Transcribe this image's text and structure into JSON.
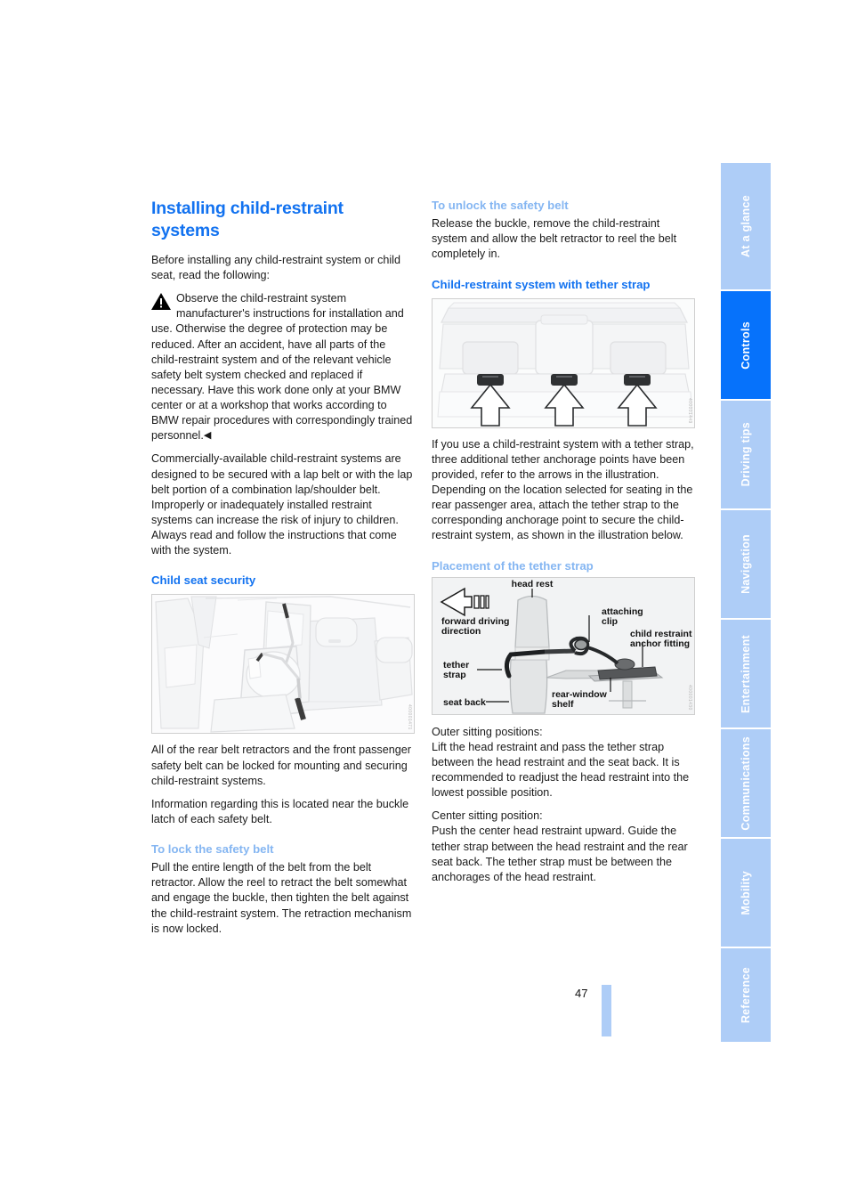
{
  "page": {
    "number": "47",
    "accent_blue": "#1272f0",
    "light_blue": "#85b6f2",
    "tab_active_blue": "#0672fb",
    "tab_inactive_blue": "#aecdf7"
  },
  "tabs": [
    {
      "label": "At a glance",
      "active": false
    },
    {
      "label": "Controls",
      "active": true
    },
    {
      "label": "Driving tips",
      "active": false
    },
    {
      "label": "Navigation",
      "active": false
    },
    {
      "label": "Entertainment",
      "active": false
    },
    {
      "label": "Communications",
      "active": false
    },
    {
      "label": "Mobility",
      "active": false
    },
    {
      "label": "Reference",
      "active": false
    }
  ],
  "left_column": {
    "title": "Installing child-restraint systems",
    "intro": "Before installing any child-restraint system or child seat, read the following:",
    "warning": "Observe the child-restraint system manufacturer's instructions for installation and use. Otherwise the degree of protection may be reduced. After an accident, have all parts of the child-restraint system and of the relevant vehicle safety belt system checked and replaced if necessary. Have this work done only at your BMW center or at a workshop that works according to BMW repair procedures with correspondingly trained personnel.",
    "warning_end_mark": "◀",
    "para_commercial": "Commercially-available child-restraint systems are designed to be secured with a lap belt or with the lap belt portion of a combination lap/shoulder belt. Improperly or inadequately installed restraint systems can increase the risk of injury to children. Always read and follow the instructions that come with the system.",
    "heading_child_seat_security": "Child seat security",
    "figure_interior_code": "400001471",
    "para_retractors": "All of the rear belt retractors and the front passenger safety belt can be locked for mounting and securing child-restraint systems.",
    "para_buckle_info": "Information regarding this is located near the buckle latch of each safety belt.",
    "heading_lock_belt": "To lock the safety belt",
    "para_lock_belt": "Pull the entire length of the belt from the belt retractor. Allow the reel to retract the belt somewhat and engage the buckle, then tighten the belt against the child-restraint system. The retraction mechanism is now locked."
  },
  "right_column": {
    "heading_unlock_belt": "To unlock the safety belt",
    "para_unlock_belt": "Release the buckle, remove the child-restraint system and allow the belt retractor to reel the belt completely in.",
    "heading_tether_system": "Child-restraint system with tether strap",
    "figure_anchorage_code": "400001449",
    "para_tether_anchorage": "If you use a child-restraint system with a tether strap, three additional tether anchorage points have been provided, refer to the arrows in the illustration. Depending on the location selected for seating in the rear passenger area, attach the tether strap to the corresponding anchorage point to secure the child-restraint system, as shown in the illustration below.",
    "heading_placement": "Placement of the tether strap",
    "figure_placement_code": "400001430",
    "figure_placement_labels": {
      "head_rest": "head rest",
      "attaching_clip": "attaching clip",
      "anchor_fitting": "child restraint anchor fitting",
      "forward_driving": "forward driving direction",
      "tether_strap": "tether strap",
      "seat_back": "seat back",
      "rear_window_shelf": "rear-window shelf"
    },
    "outer_label": "Outer sitting positions:",
    "outer_text": "Lift the head restraint and pass the tether strap between the head restraint and the seat back. It is recommended to readjust the head restraint into the lowest possible position.",
    "center_label": "Center sitting position:",
    "center_text": "Push the center head restraint upward. Guide the tether strap between the head restraint and the rear seat back. The tether strap must be between the anchorages of the head restraint."
  }
}
